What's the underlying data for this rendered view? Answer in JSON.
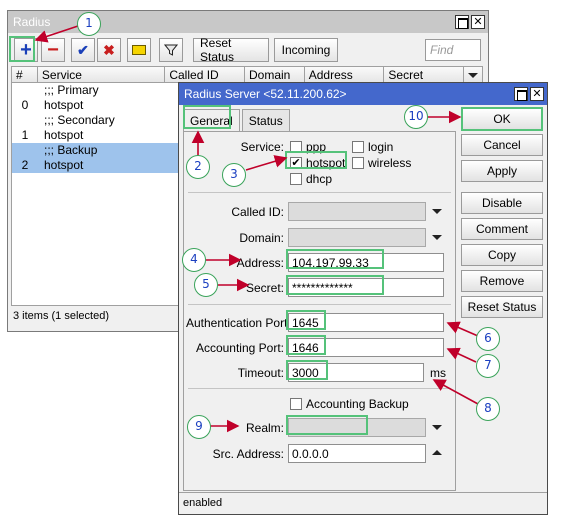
{
  "radius_window": {
    "title": "Radius",
    "minimize_label": "□",
    "close_label": "✕",
    "toolbar": {
      "add_label": "+",
      "remove_label": "−",
      "enable_label": "✔",
      "disable_label": "✖",
      "comment_label": "",
      "filter_label": "",
      "reset_status_label": "Reset Status",
      "incoming_label": "Incoming",
      "find_placeholder": "Find"
    },
    "columns": [
      "#",
      "Service",
      "Called ID",
      "Domain",
      "Address",
      "Secret"
    ],
    "rows": [
      {
        "num": "",
        "service": ";;; Primary"
      },
      {
        "num": "0",
        "service": "hotspot"
      },
      {
        "num": "",
        "service": ";;; Secondary"
      },
      {
        "num": "1",
        "service": "hotspot"
      },
      {
        "num": "",
        "service": ";;; Backup"
      },
      {
        "num": "2",
        "service": "hotspot"
      }
    ],
    "status": "3 items (1 selected)"
  },
  "server_window": {
    "title": "Radius Server <52.11.200.62>",
    "tabs": [
      "General",
      "Status"
    ],
    "service_label": "Service:",
    "services": {
      "ppp": "ppp",
      "login": "login",
      "hotspot": "hotspot",
      "wireless": "wireless",
      "dhcp": "dhcp"
    },
    "hotspot_check": "✔",
    "called_id_label": "Called ID:",
    "domain_label": "Domain:",
    "address_label": "Address:",
    "address_value": "104.197.99.33",
    "secret_label": "Secret:",
    "secret_value": "*************",
    "auth_port_label": "Authentication Port:",
    "auth_port_value": "1645",
    "acct_port_label": "Accounting Port:",
    "acct_port_value": "1646",
    "timeout_label": "Timeout:",
    "timeout_value": "3000",
    "timeout_unit": "ms",
    "acct_backup_label": "Accounting Backup",
    "realm_label": "Realm:",
    "src_address_label": "Src. Address:",
    "src_address_value": "0.0.0.0",
    "buttons": {
      "ok": "OK",
      "cancel": "Cancel",
      "apply": "Apply",
      "disable": "Disable",
      "comment": "Comment",
      "copy": "Copy",
      "remove": "Remove",
      "reset_status": "Reset Status"
    },
    "status": "enabled"
  },
  "callouts": [
    "1",
    "2",
    "3",
    "4",
    "5",
    "6",
    "7",
    "8",
    "9",
    "10"
  ],
  "colors": {
    "callout_border": "#3aa35a",
    "highlight": "#55c27a",
    "arrow": "#c0002a",
    "title_active": "#4468cc",
    "selection": "#9ec3ec"
  }
}
